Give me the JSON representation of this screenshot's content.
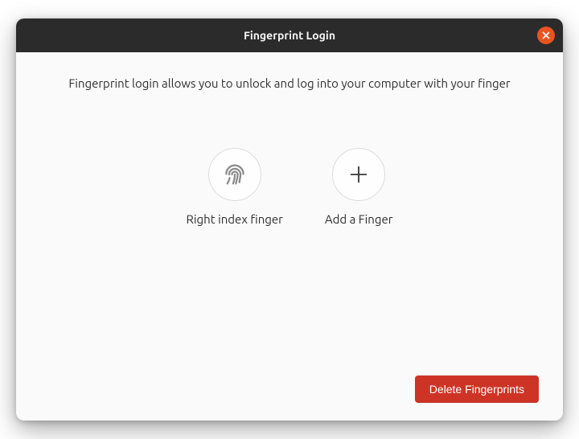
{
  "window": {
    "title": "Fingerprint Login"
  },
  "description": "Fingerprint login allows you to unlock and log into your computer with your finger",
  "fingers": {
    "enrolled": {
      "label": "Right index finger",
      "icon": "fingerprint-icon"
    },
    "add": {
      "label": "Add a Finger",
      "icon": "plus-icon"
    }
  },
  "actions": {
    "delete": "Delete Fingerprints"
  },
  "colors": {
    "accent": "#e95420",
    "destructive": "#ce3426",
    "titlebar": "#2b2b2b"
  }
}
